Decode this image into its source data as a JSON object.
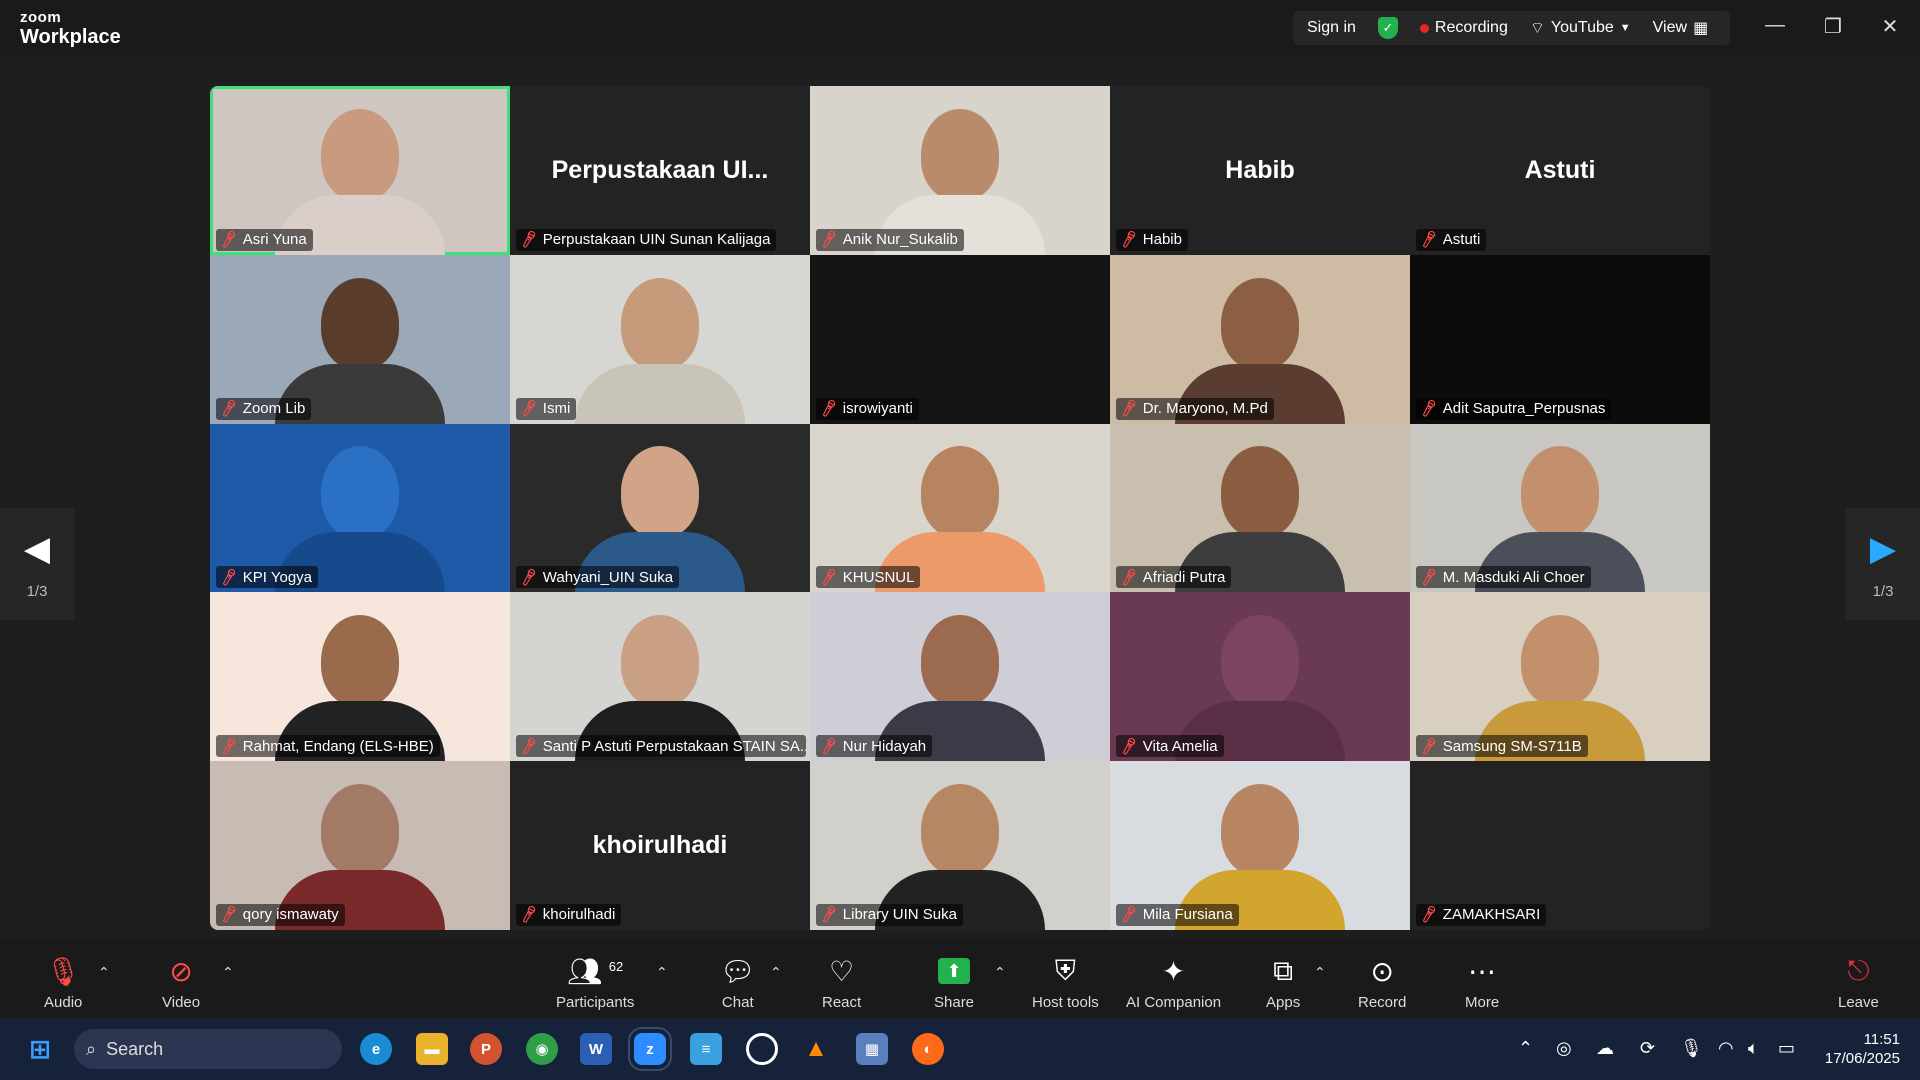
{
  "app": {
    "logo_top": "zoom",
    "logo_bottom": "Workplace"
  },
  "titlebar": {
    "sign_in": "Sign in",
    "recording": "Recording",
    "youtube": "YouTube",
    "view": "View"
  },
  "page_indicator": "1/3",
  "participants": [
    {
      "name": "Asri Yuna",
      "video": true,
      "bg": "#cfc6c1",
      "skin": "#c89a7e",
      "cloth": "#d9cfc8"
    },
    {
      "name": "Perpustakaan UIN Sunan Kalijaga",
      "big": "Perpustakaan  UI...",
      "video": false
    },
    {
      "name": "Anik Nur_Sukalib",
      "video": true,
      "bg": "#d8d4cc",
      "skin": "#b88b6a",
      "cloth": "#e4e0da"
    },
    {
      "name": "Habib",
      "big": "Habib",
      "video": false
    },
    {
      "name": "Astuti",
      "big": "Astuti",
      "video": false
    },
    {
      "name": "Zoom Lib",
      "video": true,
      "bg": "#9aa8b8",
      "skin": "#5a3c2a",
      "cloth": "#3a3a3a"
    },
    {
      "name": "Ismi",
      "video": true,
      "bg": "#d6d6d2",
      "skin": "#c59b7b",
      "cloth": "#c8c4b8"
    },
    {
      "name": "isrowiyanti",
      "video": true,
      "bg": "#141414",
      "skin": "#141414",
      "cloth": "#141414"
    },
    {
      "name": "Dr. Maryono, M.Pd",
      "video": true,
      "bg": "#cdbba4",
      "skin": "#8c5e44",
      "cloth": "#5a3d30"
    },
    {
      "name": "Adit Saputra_Perpusnas",
      "video": true,
      "bg": "#0c0c0c",
      "skin": "#0c0c0c",
      "cloth": "#0c0c0c"
    },
    {
      "name": "KPI Yogya",
      "video": true,
      "bg": "#1e5aa8",
      "skin": "#2a70c4",
      "cloth": "#174a8c"
    },
    {
      "name": "Wahyani_UIN Suka",
      "video": true,
      "bg": "#2a2a2a",
      "skin": "#d1a488",
      "cloth": "#2b5a8a"
    },
    {
      "name": "KHUSNUL",
      "video": true,
      "bg": "#d9d5cc",
      "skin": "#b78462",
      "cloth": "#ec9a6a"
    },
    {
      "name": "Afriadi Putra",
      "video": true,
      "bg": "#c8bfae",
      "skin": "#8a5c40",
      "cloth": "#3d3d3d"
    },
    {
      "name": "M. Masduki Ali Choer",
      "video": true,
      "bg": "#c9c7c2",
      "skin": "#c2906c",
      "cloth": "#4a4f5a"
    },
    {
      "name": "Rahmat, Endang (ELS-HBE)",
      "video": true,
      "bg": "#f6e6dc",
      "skin": "#9a6a4c",
      "cloth": "#222222"
    },
    {
      "name": "Santi P Astuti Perpustakaan STAIN SA...",
      "video": true,
      "bg": "#d4d4d0",
      "skin": "#caa084",
      "cloth": "#1f1f1f"
    },
    {
      "name": "Nur Hidayah",
      "video": true,
      "bg": "#cfcdd6",
      "skin": "#9c6a4e",
      "cloth": "#3b3b47"
    },
    {
      "name": "Vita Amelia",
      "video": true,
      "bg": "#6a3a52",
      "skin": "#7c4460",
      "cloth": "#5a2f46"
    },
    {
      "name": "Samsung SM-S711B",
      "video": true,
      "bg": "#d8cfc0",
      "skin": "#c2906a",
      "cloth": "#c99a3c"
    },
    {
      "name": "qory ismawaty",
      "video": true,
      "bg": "#c8bbb3",
      "skin": "#a27a66",
      "cloth": "#7a2a2a"
    },
    {
      "name": "khoirulhadi",
      "big": "khoirulhadi",
      "video": false
    },
    {
      "name": "Library UIN Suka",
      "video": true,
      "bg": "#d2d0cb",
      "skin": "#b78664",
      "cloth": "#222222"
    },
    {
      "name": "Mila Fursiana",
      "video": true,
      "bg": "#d8dbe0",
      "skin": "#b88562",
      "cloth": "#d2a52f"
    },
    {
      "name": "ZAMAKHSARI",
      "video": false,
      "big": ""
    }
  ],
  "toolbar": {
    "audio": "Audio",
    "video": "Video",
    "participants": "Participants",
    "participants_count": "62",
    "chat": "Chat",
    "react": "React",
    "share": "Share",
    "host_tools": "Host tools",
    "ai_companion": "AI Companion",
    "apps": "Apps",
    "record": "Record",
    "more": "More",
    "leave": "Leave"
  },
  "taskbar": {
    "search": "Search",
    "time": "11:51",
    "date": "17/06/2025"
  },
  "colors": {
    "active_speaker": "#3ee07a",
    "muted": "#ff4a4a",
    "share_green": "#23b14d",
    "leave_red": "#e0323a"
  }
}
